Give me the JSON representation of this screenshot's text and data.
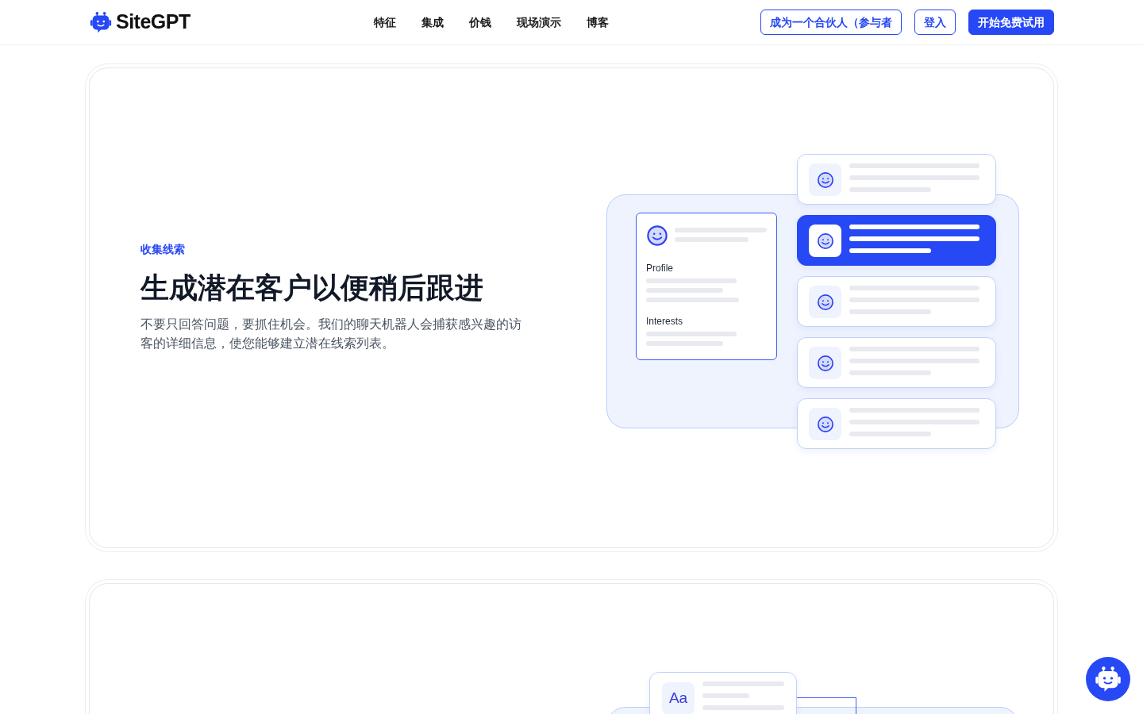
{
  "header": {
    "brand": "SiteGPT",
    "nav": [
      {
        "label": "特征"
      },
      {
        "label": "集成"
      },
      {
        "label": "价钱"
      },
      {
        "label": "现场演示"
      },
      {
        "label": "博客"
      }
    ],
    "buttons": [
      {
        "label": "成为一个合伙人（参与者",
        "kind": "outline"
      },
      {
        "label": "登入",
        "kind": "outline"
      },
      {
        "label": "开始免费试用",
        "kind": "primary"
      }
    ]
  },
  "feature": {
    "eyebrow": "收集线索",
    "title": "生成潜在客户以便稍后跟进",
    "description": "不要只回答问题，要抓住机会。我们的聊天机器人会捕获感兴趣的访客的详细信息，使您能够建立潜在线索列表。",
    "profile_card": {
      "sections": [
        {
          "label": "Profile"
        },
        {
          "label": "Interests"
        }
      ]
    },
    "visitors": [
      {
        "selected": false
      },
      {
        "selected": true
      },
      {
        "selected": false
      },
      {
        "selected": false
      },
      {
        "selected": false
      }
    ]
  },
  "next_feature": {
    "font_card": {
      "sample": "Aa"
    }
  }
}
